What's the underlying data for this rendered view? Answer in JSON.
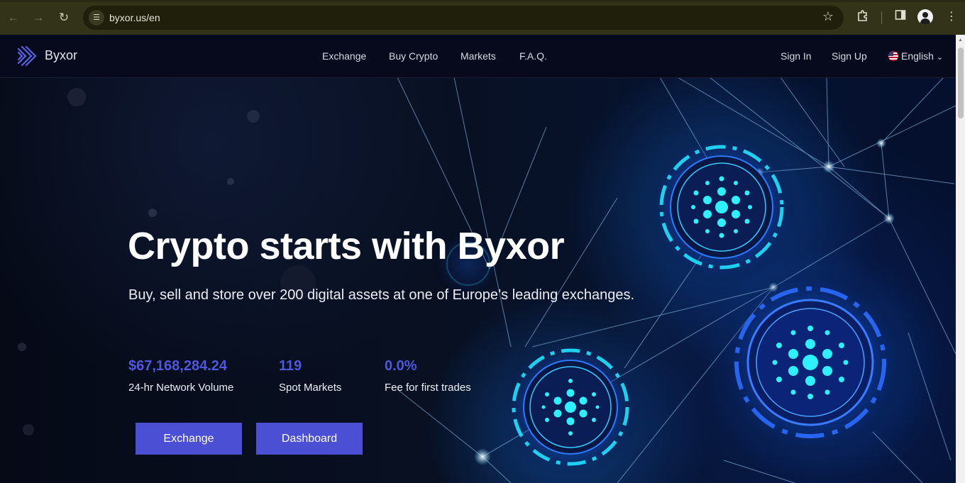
{
  "browser": {
    "url": "byxor.us/en",
    "icons": {
      "back": "arrow-left-icon",
      "forward": "arrow-right-icon",
      "reload": "reload-icon",
      "site_info": "site-settings-icon",
      "bookmark": "star-icon",
      "extensions": "puzzle-icon",
      "side_panel": "side-panel-icon",
      "profile": "profile-icon",
      "menu": "kebab-menu-icon"
    }
  },
  "header": {
    "brand": "Byxor",
    "nav": [
      "Exchange",
      "Buy Crypto",
      "Markets",
      "F.A.Q."
    ],
    "sign_in": "Sign In",
    "sign_up": "Sign Up",
    "language": "English"
  },
  "hero": {
    "title": "Crypto starts with Byxor",
    "subtitle": "Buy, sell and store over 200 digital assets at one of Europe’s leading exchanges.",
    "stats": [
      {
        "value": "$67,168,284.24",
        "label": "24-hr Network Volume"
      },
      {
        "value": "119",
        "label": "Spot Markets"
      },
      {
        "value": "0.0%",
        "label": "Fee for first trades"
      }
    ],
    "buttons": {
      "exchange": "Exchange",
      "dashboard": "Dashboard"
    }
  },
  "colors": {
    "accent": "#4b4fd3",
    "stat_value": "#4f57de",
    "header_bg": "#070a1c",
    "glow": "#19e0ff"
  }
}
